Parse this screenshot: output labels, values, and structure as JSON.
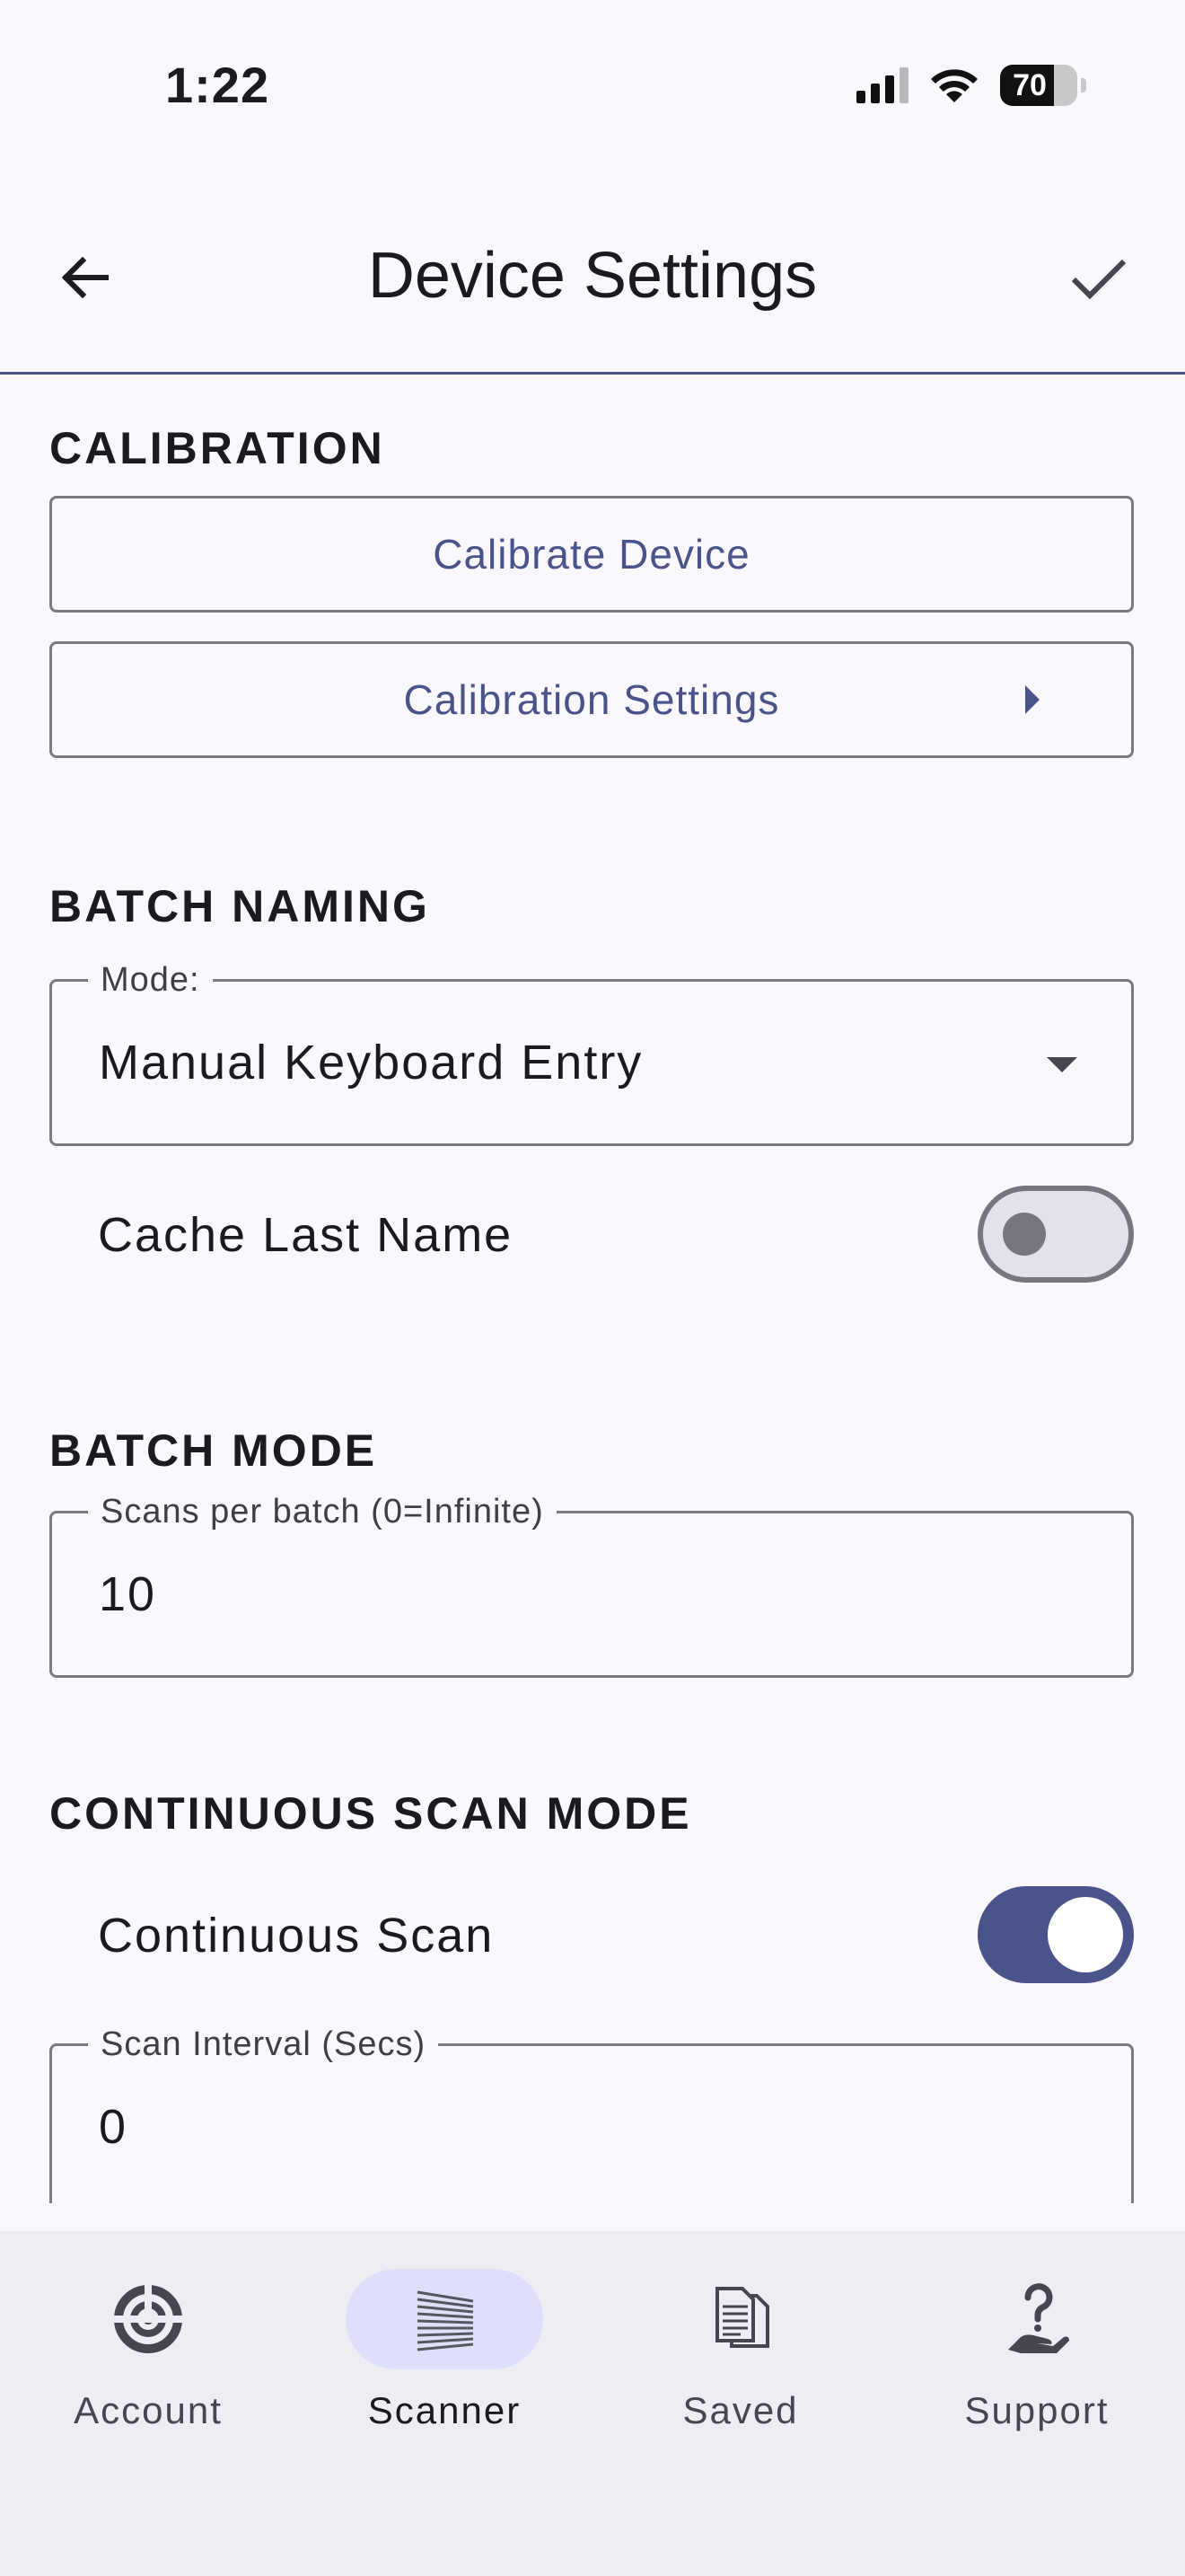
{
  "status_bar": {
    "time": "1:22",
    "battery_level": "70",
    "battery_fraction": 0.7,
    "signal_bars": 3,
    "icons": [
      "cellular-signal-icon",
      "wifi-icon",
      "battery-icon"
    ]
  },
  "app_bar": {
    "title": "Device Settings",
    "back_icon": "arrow-left-icon",
    "confirm_icon": "check-icon"
  },
  "calibration": {
    "header": "CALIBRATION",
    "calibrate_label": "Calibrate Device",
    "settings_label": "Calibration Settings"
  },
  "batch_naming": {
    "header": "BATCH NAMING",
    "mode_label": "Mode:",
    "mode_value": "Manual Keyboard Entry",
    "cache_label": "Cache Last Name",
    "cache_enabled": false
  },
  "batch_mode": {
    "header": "BATCH MODE",
    "scans_label": "Scans per batch (0=Infinite)",
    "scans_value": "10"
  },
  "continuous_scan": {
    "header": "CONTINUOUS SCAN MODE",
    "toggle_label": "Continuous Scan",
    "toggle_enabled": true,
    "interval_label": "Scan Interval (Secs)",
    "interval_value": "0"
  },
  "bottom_nav": {
    "active": "scanner",
    "items": [
      {
        "id": "account",
        "label": "Account",
        "icon": "target-icon"
      },
      {
        "id": "scanner",
        "label": "Scanner",
        "icon": "scanner-beam-icon"
      },
      {
        "id": "saved",
        "label": "Saved",
        "icon": "documents-icon"
      },
      {
        "id": "support",
        "label": "Support",
        "icon": "help-hand-icon"
      }
    ]
  },
  "colors": {
    "accent": "#4b548a",
    "background": "#fbf8fd",
    "nav_background": "#efedf4",
    "active_pill": "#dee0f9",
    "outline": "#7a7a80"
  }
}
